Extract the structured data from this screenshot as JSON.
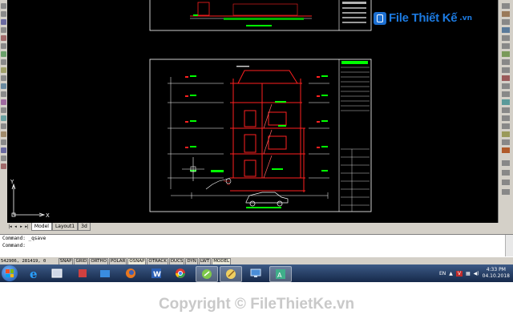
{
  "watermark": {
    "brand": "File Thiết Kế",
    "domain": ".vn"
  },
  "drawing": {
    "top_sheet_caption": "MẶT CẮT B - B",
    "main_sheet_caption": "MẶT CẮT B - B 1/100"
  },
  "layout_tabs": [
    "Model",
    "Layout1",
    "3d"
  ],
  "command": {
    "history": "Command: _qsave",
    "prompt": "Command:"
  },
  "status_bar": {
    "coordinates": "542906, 281419, 0",
    "toggles": [
      "SNAP",
      "GRID",
      "ORTHO",
      "POLAR",
      "OSNAP",
      "OTRACK",
      "DUCS",
      "DYN",
      "LWT",
      "MODEL"
    ]
  },
  "taskbar": {
    "apps": [
      "internet-explorer-icon",
      "file-explorer-icon",
      "settings-icon",
      "folder-icon",
      "firefox-icon",
      "word-icon",
      "chrome-icon",
      "autocad-icon",
      "paint-icon",
      "remote-desktop-icon",
      "terminal-icon"
    ],
    "language": "EN",
    "time": "4:33 PM",
    "date": "04.10.2018"
  },
  "copyright": "Copyright © FileThietKe.vn",
  "colors": {
    "canvas": "#000000",
    "sheet_border": "#ffffff",
    "section_line": "#ff2020",
    "dim_line": "#ffffff",
    "level_mark": "#00ff00"
  },
  "ucs": {
    "x_label": "X",
    "y_label": "Y"
  }
}
